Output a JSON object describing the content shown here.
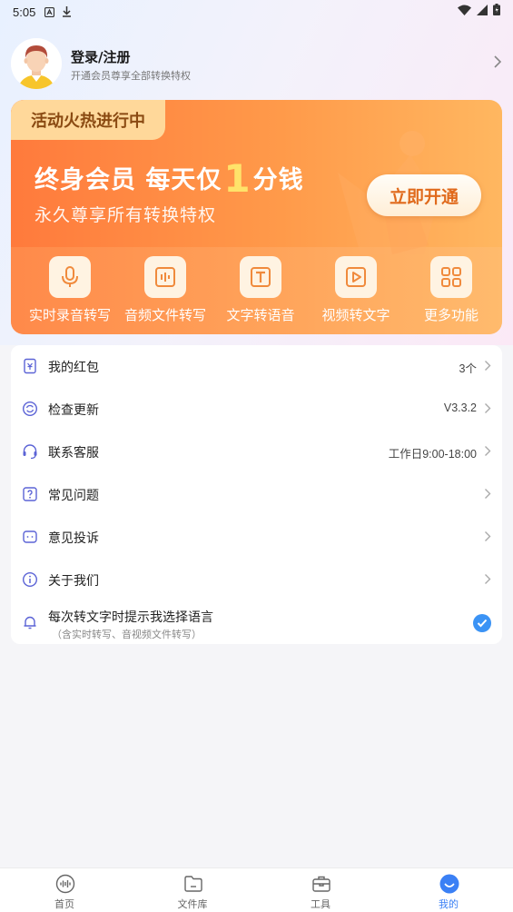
{
  "status_bar": {
    "time": "5:05"
  },
  "profile": {
    "title": "登录/注册",
    "subtitle": "开通会员尊享全部转换特权"
  },
  "promo": {
    "tag": "活动火热进行中",
    "headline_prefix": "终身会员 每天仅",
    "headline_number": "1",
    "headline_suffix": "分钱",
    "subtitle": "永久尊享所有转换特权",
    "button": "立即开通",
    "features": [
      {
        "label": "实时录音转写",
        "icon": "microphone-icon"
      },
      {
        "label": "音频文件转写",
        "icon": "audio-wave-icon"
      },
      {
        "label": "文字转语音",
        "icon": "text-t-icon"
      },
      {
        "label": "视频转文字",
        "icon": "video-play-icon"
      },
      {
        "label": "更多功能",
        "icon": "grid-icon"
      }
    ]
  },
  "menu": {
    "items": [
      {
        "label": "我的红包",
        "value": "3个",
        "icon": "red-packet-icon"
      },
      {
        "label": "检查更新",
        "value": "V3.3.2",
        "icon": "refresh-icon"
      },
      {
        "label": "联系客服",
        "value": "工作日9:00-18:00",
        "icon": "headset-icon"
      },
      {
        "label": "常见问题",
        "value": "",
        "icon": "question-icon"
      },
      {
        "label": "意见投诉",
        "value": "",
        "icon": "feedback-icon"
      },
      {
        "label": "关于我们",
        "value": "",
        "icon": "info-icon"
      }
    ],
    "language_prompt": {
      "title": "每次转文字时提示我选择语言",
      "subtitle": "（含实时转写、音视频文件转写）",
      "checked": true,
      "icon": "bell-icon"
    }
  },
  "bottom_nav": {
    "items": [
      {
        "label": "首页",
        "icon": "home-wave-icon",
        "active": false
      },
      {
        "label": "文件库",
        "icon": "folder-icon",
        "active": false
      },
      {
        "label": "工具",
        "icon": "toolbox-icon",
        "active": false
      },
      {
        "label": "我的",
        "icon": "profile-smile-icon",
        "active": true
      }
    ]
  },
  "colors": {
    "accent": "#3b80f5",
    "promo_orange": "#ff8a42",
    "menu_icon": "#5b63d6"
  }
}
